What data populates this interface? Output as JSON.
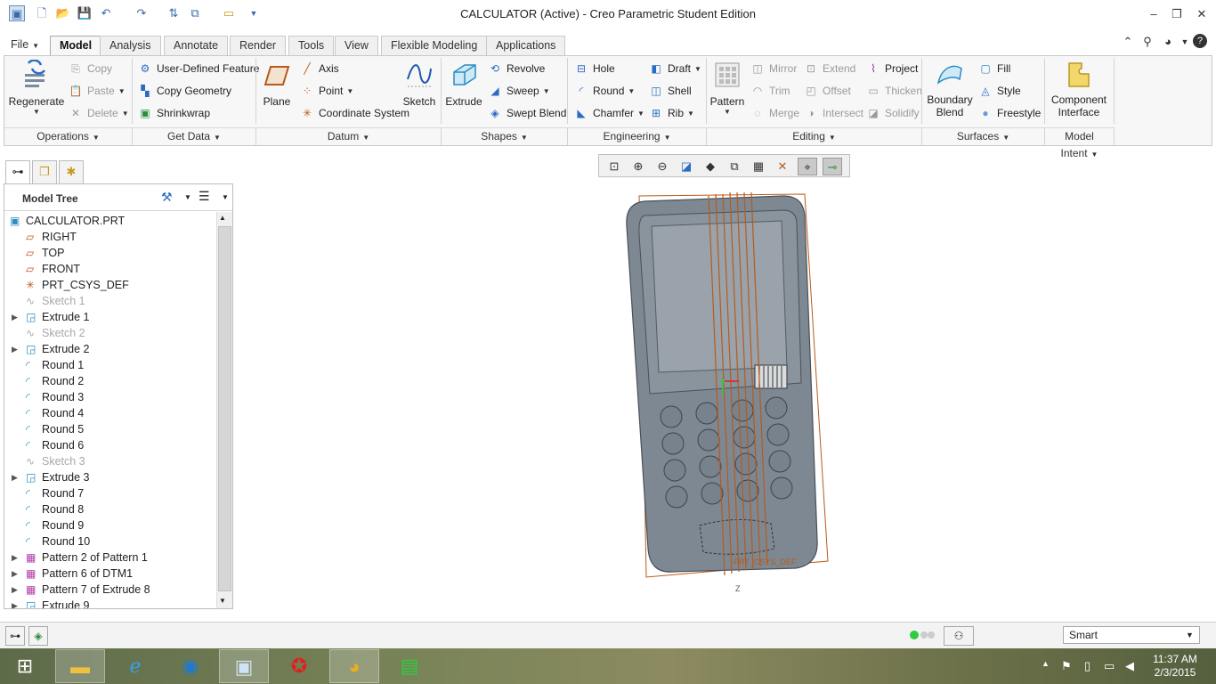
{
  "window": {
    "title": "CALCULATOR (Active) - Creo Parametric Student Edition"
  },
  "tabs": [
    {
      "label": "File",
      "active": false
    },
    {
      "label": "Model",
      "active": true
    },
    {
      "label": "Analysis",
      "active": false
    },
    {
      "label": "Annotate",
      "active": false
    },
    {
      "label": "Render",
      "active": false
    },
    {
      "label": "Tools",
      "active": false
    },
    {
      "label": "View",
      "active": false
    },
    {
      "label": "Flexible Modeling",
      "active": false
    },
    {
      "label": "Applications",
      "active": false
    }
  ],
  "ribbon": {
    "operations": {
      "label": "Operations",
      "regenerate": "Regenerate",
      "copy": "Copy",
      "paste": "Paste",
      "delete": "Delete"
    },
    "getdata": {
      "label": "Get Data",
      "udf": "User-Defined Feature",
      "copy_geometry": "Copy Geometry",
      "shrinkwrap": "Shrinkwrap"
    },
    "datum": {
      "label": "Datum",
      "plane": "Plane",
      "axis": "Axis",
      "point": "Point",
      "csys": "Coordinate System",
      "sketch": "Sketch"
    },
    "shapes": {
      "label": "Shapes",
      "extrude": "Extrude",
      "revolve": "Revolve",
      "sweep": "Sweep",
      "swept_blend": "Swept Blend"
    },
    "engineering": {
      "label": "Engineering",
      "hole": "Hole",
      "round": "Round",
      "chamfer": "Chamfer",
      "draft": "Draft",
      "shell": "Shell",
      "rib": "Rib"
    },
    "editing": {
      "label": "Editing",
      "pattern": "Pattern",
      "mirror": "Mirror",
      "trim": "Trim",
      "merge": "Merge",
      "extend": "Extend",
      "offset": "Offset",
      "intersect": "Intersect",
      "project": "Project",
      "thicken": "Thicken",
      "solidify": "Solidify"
    },
    "surfaces": {
      "label": "Surfaces",
      "boundary_blend_1": "Boundary",
      "boundary_blend_2": "Blend",
      "fill": "Fill",
      "style": "Style",
      "freestyle": "Freestyle"
    },
    "modelintent": {
      "label": "Model Intent",
      "component_interface_1": "Component",
      "component_interface_2": "Interface"
    }
  },
  "model_tree": {
    "title": "Model Tree",
    "items": [
      {
        "label": "CALCULATOR.PRT",
        "icon": "part-icon",
        "expandable": false,
        "suppressed": false,
        "indent": 0
      },
      {
        "label": "RIGHT",
        "icon": "datum-plane-icon",
        "expandable": false,
        "suppressed": false,
        "indent": 1
      },
      {
        "label": "TOP",
        "icon": "datum-plane-icon",
        "expandable": false,
        "suppressed": false,
        "indent": 1
      },
      {
        "label": "FRONT",
        "icon": "datum-plane-icon",
        "expandable": false,
        "suppressed": false,
        "indent": 1
      },
      {
        "label": "PRT_CSYS_DEF",
        "icon": "csys-icon",
        "expandable": false,
        "suppressed": false,
        "indent": 1
      },
      {
        "label": "Sketch 1",
        "icon": "sketch-icon",
        "expandable": false,
        "suppressed": true,
        "indent": 1
      },
      {
        "label": "Extrude 1",
        "icon": "extrude-icon",
        "expandable": true,
        "suppressed": false,
        "indent": 1
      },
      {
        "label": "Sketch 2",
        "icon": "sketch-icon",
        "expandable": false,
        "suppressed": true,
        "indent": 1
      },
      {
        "label": "Extrude 2",
        "icon": "extrude-icon",
        "expandable": true,
        "suppressed": false,
        "indent": 1
      },
      {
        "label": "Round 1",
        "icon": "round-icon",
        "expandable": false,
        "suppressed": false,
        "indent": 1
      },
      {
        "label": "Round 2",
        "icon": "round-icon",
        "expandable": false,
        "suppressed": false,
        "indent": 1
      },
      {
        "label": "Round 3",
        "icon": "round-icon",
        "expandable": false,
        "suppressed": false,
        "indent": 1
      },
      {
        "label": "Round 4",
        "icon": "round-icon",
        "expandable": false,
        "suppressed": false,
        "indent": 1
      },
      {
        "label": "Round 5",
        "icon": "round-icon",
        "expandable": false,
        "suppressed": false,
        "indent": 1
      },
      {
        "label": "Round 6",
        "icon": "round-icon",
        "expandable": false,
        "suppressed": false,
        "indent": 1
      },
      {
        "label": "Sketch 3",
        "icon": "sketch-icon",
        "expandable": false,
        "suppressed": true,
        "indent": 1
      },
      {
        "label": "Extrude 3",
        "icon": "extrude-icon",
        "expandable": true,
        "suppressed": false,
        "indent": 1
      },
      {
        "label": "Round 7",
        "icon": "round-icon",
        "expandable": false,
        "suppressed": false,
        "indent": 1
      },
      {
        "label": "Round 8",
        "icon": "round-icon",
        "expandable": false,
        "suppressed": false,
        "indent": 1
      },
      {
        "label": "Round 9",
        "icon": "round-icon",
        "expandable": false,
        "suppressed": false,
        "indent": 1
      },
      {
        "label": "Round 10",
        "icon": "round-icon",
        "expandable": false,
        "suppressed": false,
        "indent": 1
      },
      {
        "label": "Pattern 2 of Pattern 1",
        "icon": "pattern-icon",
        "expandable": true,
        "suppressed": false,
        "indent": 1
      },
      {
        "label": "Pattern 6 of DTM1",
        "icon": "pattern-icon",
        "expandable": true,
        "suppressed": false,
        "indent": 1
      },
      {
        "label": "Pattern 7 of Extrude 8",
        "icon": "pattern-icon",
        "expandable": true,
        "suppressed": false,
        "indent": 1
      },
      {
        "label": "Extrude 9",
        "icon": "extrude-icon",
        "expandable": true,
        "suppressed": false,
        "indent": 1
      }
    ]
  },
  "viewport": {
    "csys_label": "PRT_CSYS_DEF",
    "axis_label": "Z"
  },
  "status": {
    "filter": "Smart"
  },
  "taskbar": {
    "time": "11:37 AM",
    "date": "2/3/2015"
  },
  "colors": {
    "accent": "#2a6cc4",
    "datum": "#b85a1a",
    "model": "#7d8893"
  }
}
